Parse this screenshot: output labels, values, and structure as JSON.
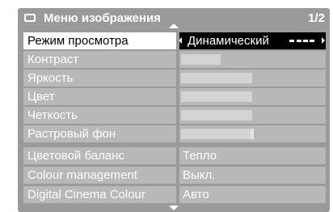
{
  "header": {
    "title": "Меню изображения",
    "page": "1/2"
  },
  "icons": {
    "menu": "picture-menu-icon",
    "scroll_up": "arrow-up-icon",
    "scroll_down": "arrow-down-icon"
  },
  "colors": {
    "panel": "#9a9a9a",
    "cell": "#b8b8b8",
    "bar": "#d4d4d4",
    "selected_label_bg": "#ffffff",
    "selected_value_bg": "#000000"
  },
  "rows": [
    {
      "label": "Режим просмотра",
      "value": "Динамический",
      "selected": true,
      "position_index": 1,
      "position_count": 4
    },
    {
      "label": "Контраст",
      "level": 0.28
    },
    {
      "label": "Яркость",
      "level": 0.5
    },
    {
      "label": "Цвет",
      "level": 0.5
    },
    {
      "label": "Четкость",
      "level": 0.5
    },
    {
      "label": "Растровый фон",
      "level": 0.5,
      "centered": true
    },
    {
      "label": "Цветовой баланс",
      "value": "Тепло"
    },
    {
      "label": "Colour management",
      "value": "Выкл."
    },
    {
      "label": "Digital Cinema Colour",
      "value": "Авто"
    }
  ]
}
